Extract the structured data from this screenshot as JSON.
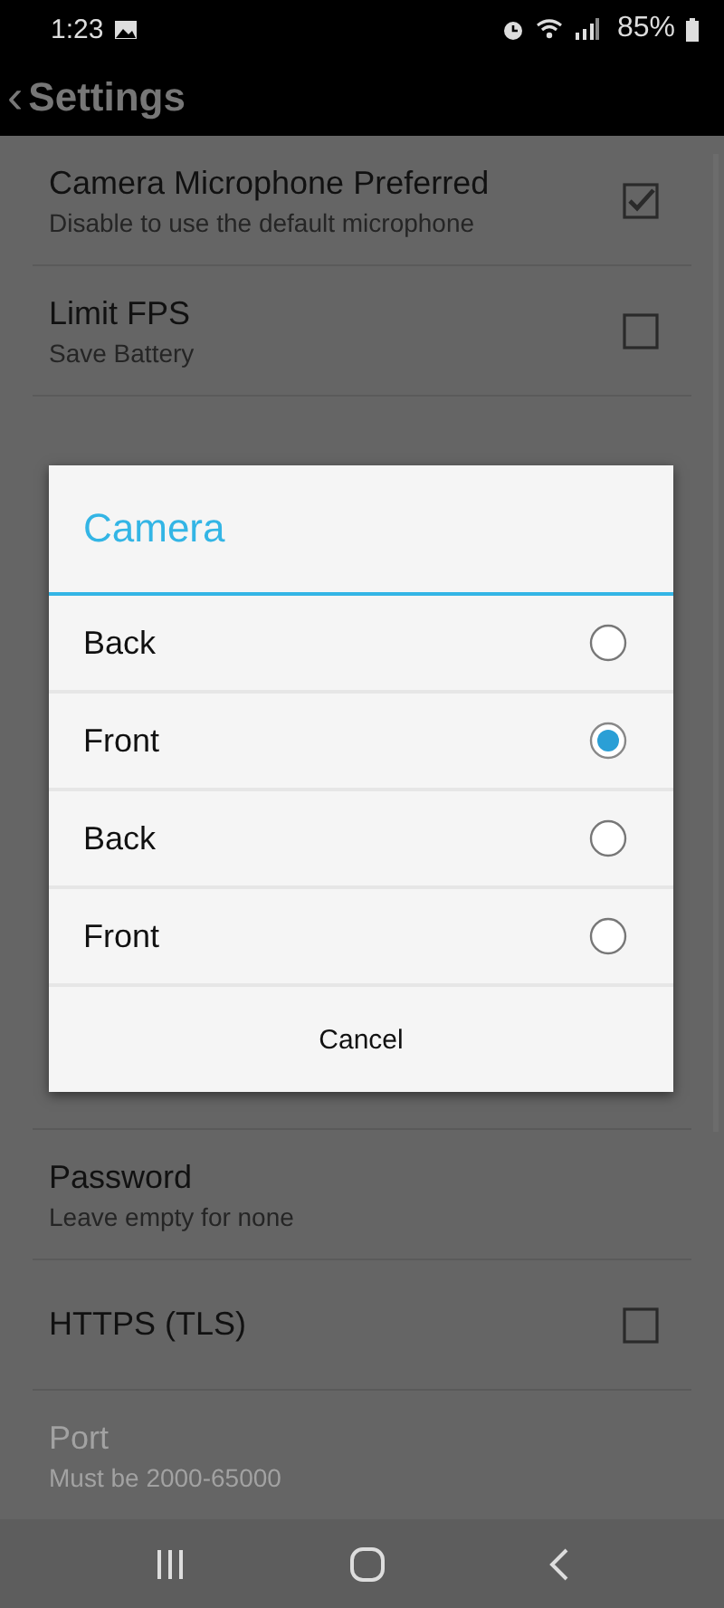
{
  "status_bar": {
    "time": "1:23",
    "battery": "85%"
  },
  "header": {
    "back": "‹",
    "title": "Settings"
  },
  "settings": [
    {
      "title": "Camera Microphone Preferred",
      "subtitle": "Disable to use the default microphone",
      "kind": "checkbox",
      "checked": true,
      "disabled": false
    },
    {
      "title": "Limit FPS",
      "subtitle": "Save Battery",
      "kind": "checkbox",
      "checked": false,
      "disabled": false
    },
    {
      "kind": "hidden"
    },
    {
      "title": "Password",
      "subtitle": "Leave empty for none",
      "kind": "text",
      "disabled": false
    },
    {
      "title": "HTTPS (TLS)",
      "kind": "checkbox",
      "checked": false,
      "disabled": false
    },
    {
      "title": "Port",
      "subtitle": "Must be 2000-65000",
      "kind": "text",
      "disabled": true
    }
  ],
  "dialog": {
    "title": "Camera",
    "options": [
      {
        "label": "Back",
        "selected": false
      },
      {
        "label": "Front",
        "selected": true
      },
      {
        "label": "Back",
        "selected": false
      },
      {
        "label": "Front",
        "selected": false
      }
    ],
    "cancel": "Cancel"
  }
}
